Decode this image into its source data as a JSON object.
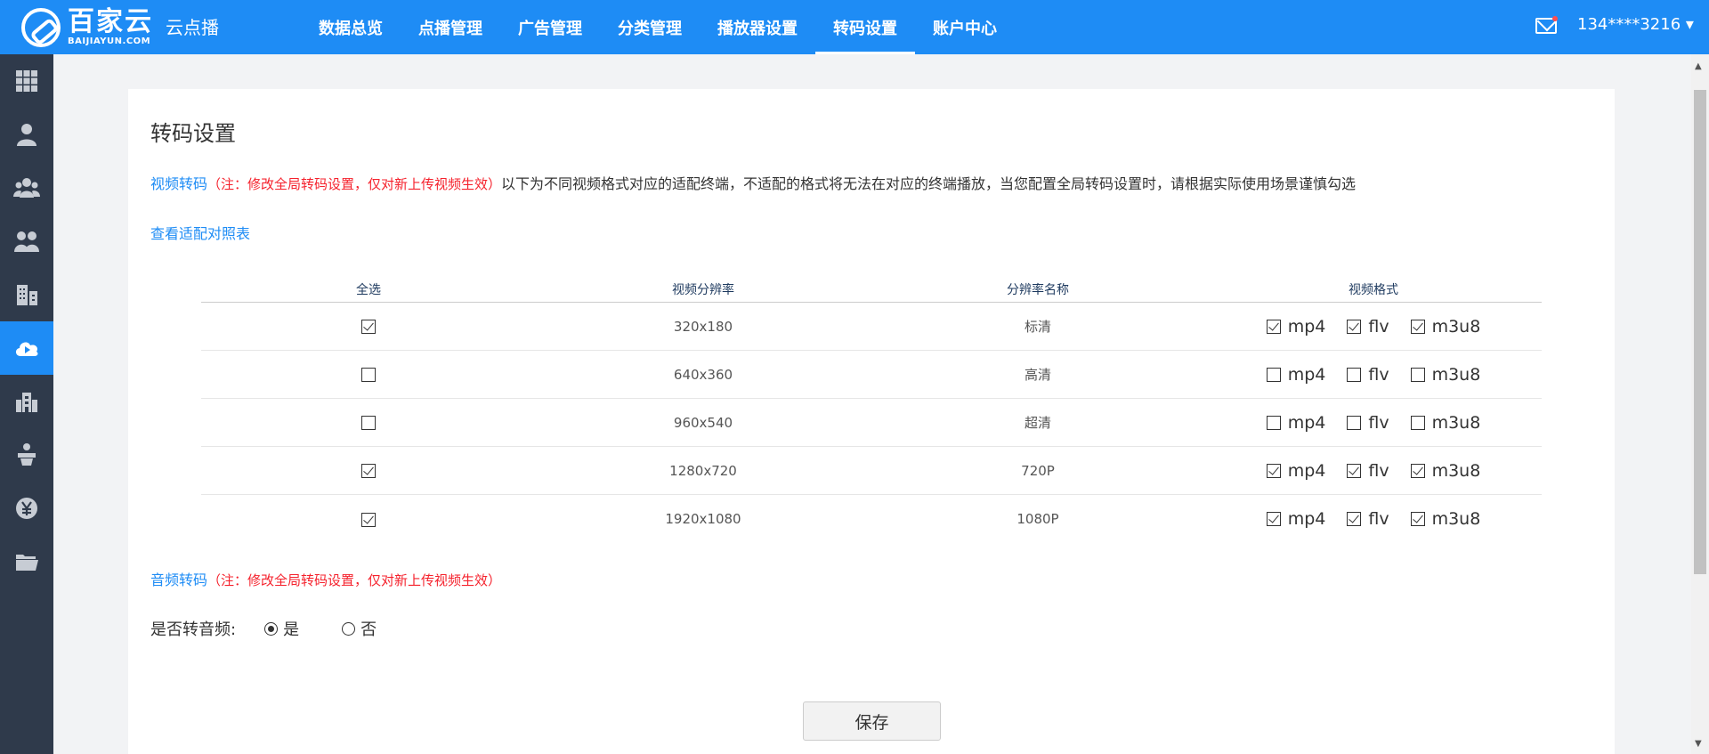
{
  "header": {
    "logo_cn": "百家云",
    "logo_en": "BAIJIAYUN.COM",
    "product": "云点播",
    "nav": [
      "数据总览",
      "点播管理",
      "广告管理",
      "分类管理",
      "播放器设置",
      "转码设置",
      "账户中心"
    ],
    "active_nav": "转码设置",
    "user": "134****3216 ▾"
  },
  "sidebar": {
    "items": [
      "grid-icon",
      "person-icon",
      "group-icon",
      "users-icon",
      "building-icon",
      "cloud-play-icon",
      "city-icon",
      "podium-icon",
      "yuan-icon",
      "folder-icon"
    ],
    "active_index": 5
  },
  "page": {
    "title": "转码设置",
    "video_label": "视频转码",
    "video_note": "（注：修改全局转码设置，仅对新上传视频生效）",
    "video_desc": "以下为不同视频格式对应的适配终端，不适配的格式将无法在对应的终端播放，当您配置全局转码设置时，请根据实际使用场景谨慎勾选",
    "compare_link": "查看适配对照表",
    "audio_label": "音频转码",
    "audio_note": "（注：修改全局转码设置，仅对新上传视频生效）",
    "audio_question": "是否转音频:",
    "audio_yes": "是",
    "audio_no": "否",
    "audio_selected": "yes",
    "save_label": "保存"
  },
  "table": {
    "headers": [
      "全选",
      "视频分辨率",
      "分辨率名称",
      "视频格式"
    ],
    "formats": [
      "mp4",
      "flv",
      "m3u8"
    ],
    "rows": [
      {
        "checked": true,
        "resolution": "320x180",
        "name": "标清",
        "mp4": true,
        "flv": true,
        "m3u8": true
      },
      {
        "checked": false,
        "resolution": "640x360",
        "name": "高清",
        "mp4": false,
        "flv": false,
        "m3u8": false
      },
      {
        "checked": false,
        "resolution": "960x540",
        "name": "超清",
        "mp4": false,
        "flv": false,
        "m3u8": false
      },
      {
        "checked": true,
        "resolution": "1280x720",
        "name": "720P",
        "mp4": true,
        "flv": true,
        "m3u8": true
      },
      {
        "checked": true,
        "resolution": "1920x1080",
        "name": "1080P",
        "mp4": true,
        "flv": true,
        "m3u8": true
      }
    ]
  },
  "colors": {
    "primary": "#1e8cf5",
    "sidebar": "#2f3a4b",
    "note": "#f5222d"
  }
}
